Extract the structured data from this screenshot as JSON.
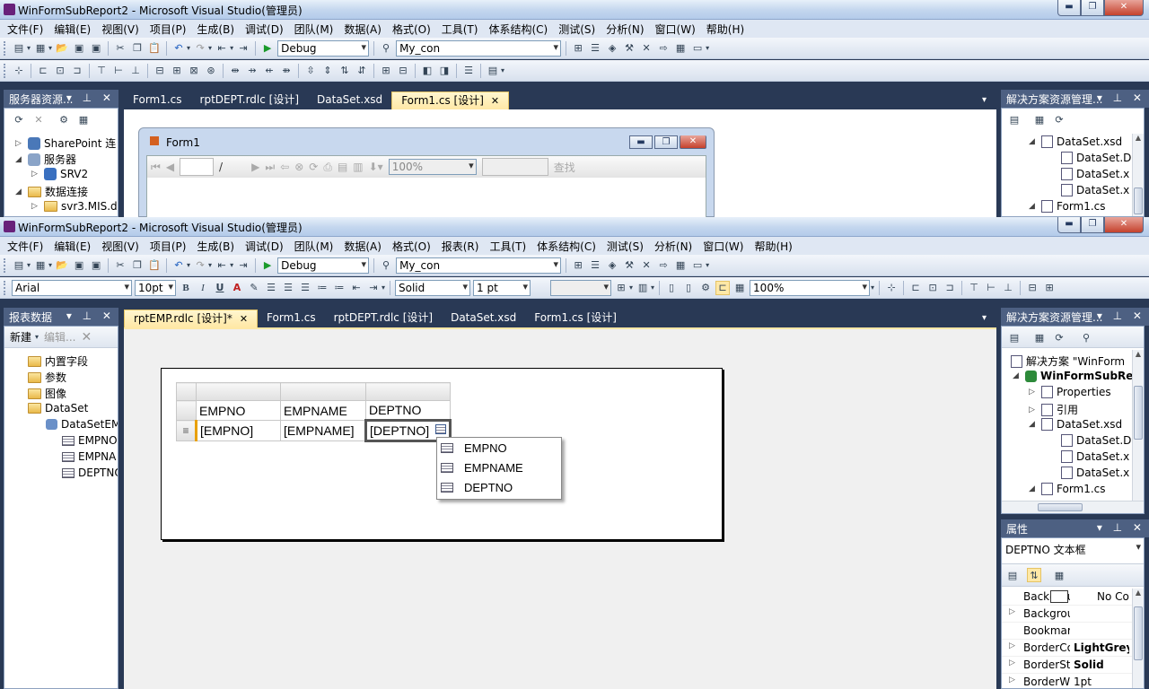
{
  "window1": {
    "title": "WinFormSubReport2 - Microsoft Visual Studio(管理员)",
    "menu": [
      "文件(F)",
      "编辑(E)",
      "视图(V)",
      "项目(P)",
      "生成(B)",
      "调试(D)",
      "团队(M)",
      "数据(A)",
      "格式(O)",
      "工具(T)",
      "体系结构(C)",
      "测试(S)",
      "分析(N)",
      "窗口(W)",
      "帮助(H)"
    ],
    "config": "Debug",
    "connection": "My_con",
    "left_panel_title": "服务器资源...",
    "server_tree": [
      "SharePoint 连",
      "服务器",
      "SRV2",
      "数据连接",
      "svr3.MIS.d"
    ],
    "tabs": [
      "Form1.cs",
      "rptDEPT.rdlc [设计]",
      "DataSet.xsd",
      "Form1.cs [设计]"
    ],
    "form_title": "Form1",
    "viewer": {
      "zoom": "100%",
      "find": "查找",
      "page_sep": "/"
    },
    "right_panel_title": "解决方案资源管理...",
    "solution_tree": [
      "DataSet.xsd",
      "DataSet.D",
      "DataSet.x",
      "DataSet.x",
      "Form1.cs"
    ]
  },
  "window2": {
    "title": "WinFormSubReport2 - Microsoft Visual Studio(管理员)",
    "menu": [
      "文件(F)",
      "编辑(E)",
      "视图(V)",
      "项目(P)",
      "生成(B)",
      "调试(D)",
      "团队(M)",
      "数据(A)",
      "格式(O)",
      "报表(R)",
      "工具(T)",
      "体系结构(C)",
      "测试(S)",
      "分析(N)",
      "窗口(W)",
      "帮助(H)"
    ],
    "config": "Debug",
    "connection": "My_con",
    "font": "Arial",
    "font_size": "10pt",
    "format_letters": [
      "B",
      "I",
      "U",
      "A"
    ],
    "border_style": "Solid",
    "border_width": "1 pt",
    "zoom": "100%",
    "left_panel_title": "报表数据",
    "new_label": "新建",
    "edit_label": "编辑...",
    "report_tree": [
      "内置字段",
      "参数",
      "图像",
      "DataSet",
      "DataSetEM",
      "EMPNO",
      "EMPNA",
      "DEPTNO"
    ],
    "tabs": [
      "rptEMP.rdlc [设计]*",
      "Form1.cs",
      "rptDEPT.rdlc [设计]",
      "DataSet.xsd",
      "Form1.cs [设计]"
    ],
    "table": {
      "headers": [
        "EMPNO",
        "EMPNAME",
        "DEPTNO"
      ],
      "cells": [
        "[EMPNO]",
        "[EMPNAME]",
        "[DEPTNO]"
      ],
      "row_marker": "≡"
    },
    "field_popup": [
      "EMPNO",
      "EMPNAME",
      "DEPTNO"
    ],
    "right_panel_title": "解决方案资源管理...",
    "solution_tree": [
      "解决方案 \"WinForm",
      "WinFormSubRe",
      "Properties",
      "引用",
      "DataSet.xsd",
      "DataSet.D",
      "DataSet.x",
      "DataSet.x",
      "Form1.cs"
    ],
    "props_title": "属性",
    "props_object": "DEPTNO 文本框",
    "props": [
      {
        "name": "Backgrou",
        "value": "No Co"
      },
      {
        "name": "Backgrou",
        "value": ""
      },
      {
        "name": "Bookmar",
        "value": ""
      },
      {
        "name": "BorderCo",
        "value": "LightGrey"
      },
      {
        "name": "BorderSt",
        "value": "Solid"
      },
      {
        "name": "BorderW",
        "value": "1pt"
      }
    ]
  }
}
